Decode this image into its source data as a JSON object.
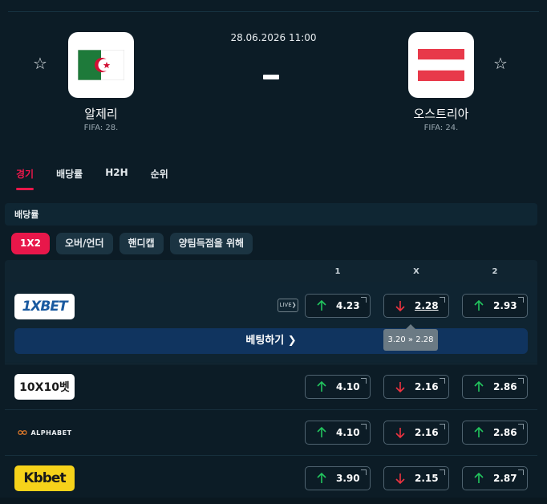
{
  "match": {
    "datetime": "28.06.2026 11:00",
    "home": {
      "name": "알제리",
      "fifa": "FIFA: 28."
    },
    "away": {
      "name": "오스트리아",
      "fifa": "FIFA: 24."
    }
  },
  "tabs": [
    "경기",
    "배당률",
    "H2H",
    "순위"
  ],
  "section_title": "배당률",
  "market_chips": [
    "1X2",
    "오버/언더",
    "핸디캡",
    "양팀득점을 위해"
  ],
  "columns": [
    "1",
    "X",
    "2"
  ],
  "bookmakers": [
    {
      "name": "1XBET",
      "live": "LIVE",
      "odds": [
        {
          "value": "4.23",
          "trend": "up"
        },
        {
          "value": "2.28",
          "trend": "down"
        },
        {
          "value": "2.93",
          "trend": "up"
        }
      ],
      "bet_label": "베팅하기"
    },
    {
      "name": "10X10벳",
      "odds": [
        {
          "value": "4.10",
          "trend": "up"
        },
        {
          "value": "2.16",
          "trend": "down"
        },
        {
          "value": "2.86",
          "trend": "up"
        }
      ]
    },
    {
      "name": "ALPHABET",
      "odds": [
        {
          "value": "4.10",
          "trend": "up"
        },
        {
          "value": "2.16",
          "trend": "down"
        },
        {
          "value": "2.86",
          "trend": "up"
        }
      ]
    },
    {
      "name": "Kbbet",
      "odds": [
        {
          "value": "3.90",
          "trend": "up"
        },
        {
          "value": "2.15",
          "trend": "down"
        },
        {
          "value": "2.87",
          "trend": "up"
        }
      ]
    }
  ],
  "tooltip": "3.20 » 2.28",
  "colors": {
    "accent": "#e8174a",
    "up": "#22c55e",
    "down": "#ef3340",
    "bet_button": "#10345f"
  }
}
